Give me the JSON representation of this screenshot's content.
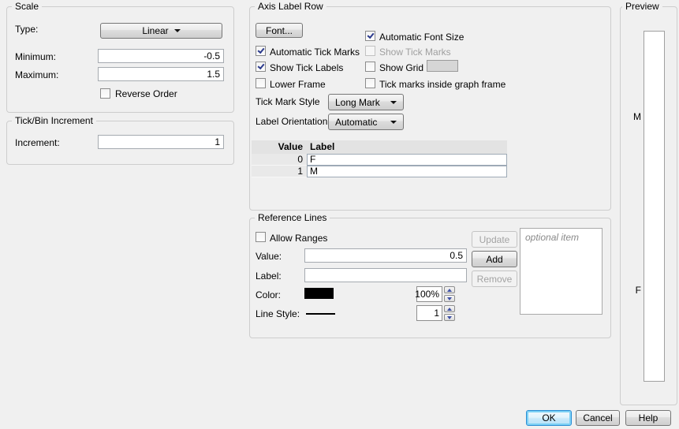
{
  "scale": {
    "title": "Scale",
    "type_label": "Type:",
    "type_value": "Linear",
    "minimum_label": "Minimum:",
    "minimum_value": "-0.5",
    "maximum_label": "Maximum:",
    "maximum_value": "1.5",
    "reverse_order_label": "Reverse Order",
    "reverse_order_checked": false
  },
  "tick_bin_increment": {
    "title": "Tick/Bin Increment",
    "increment_label": "Increment:",
    "increment_value": "1"
  },
  "axis_label_row": {
    "title": "Axis Label Row",
    "font_button_label": "Font...",
    "checkboxes": {
      "automatic_font_size": {
        "label": "Automatic Font Size",
        "checked": true
      },
      "automatic_tick_marks": {
        "label": "Automatic Tick Marks",
        "checked": true
      },
      "show_tick_marks": {
        "label": "Show Tick Marks",
        "checked": false,
        "disabled": true
      },
      "show_tick_labels": {
        "label": "Show Tick Labels",
        "checked": true
      },
      "show_grid": {
        "label": "Show Grid",
        "checked": false
      },
      "lower_frame": {
        "label": "Lower Frame",
        "checked": false
      },
      "tick_marks_inside": {
        "label": "Tick marks inside graph frame",
        "checked": false
      }
    },
    "show_grid_swatch_color": "#d6d6d6",
    "tick_mark_style_label": "Tick Mark Style",
    "tick_mark_style_value": "Long Mark",
    "label_orientation_label": "Label Orientation",
    "label_orientation_value": "Automatic",
    "table": {
      "headers": {
        "value": "Value",
        "label": "Label"
      },
      "rows": [
        {
          "value": "0",
          "label": "F"
        },
        {
          "value": "1",
          "label": "M"
        }
      ]
    }
  },
  "reference_lines": {
    "title": "Reference Lines",
    "allow_ranges_label": "Allow Ranges",
    "allow_ranges_checked": false,
    "value_label": "Value:",
    "value": "0.5",
    "label_label": "Label:",
    "label_value": "",
    "color_label": "Color:",
    "color_swatch": "#000000",
    "opacity_value": "100%",
    "line_style_label": "Line Style:",
    "line_width_value": "1",
    "update_button": "Update",
    "add_button": "Add",
    "remove_button": "Remove",
    "list_placeholder": "optional item"
  },
  "preview": {
    "title": "Preview",
    "tick_labels": [
      {
        "text": "M"
      },
      {
        "text": "F"
      }
    ]
  },
  "footer": {
    "ok_label": "OK",
    "cancel_label": "Cancel",
    "help_label": "Help"
  },
  "colors": {
    "dialog_background": "#f0f0f0",
    "checkmark": "#2b3a8c",
    "default_button_border": "#2a8dd4"
  }
}
